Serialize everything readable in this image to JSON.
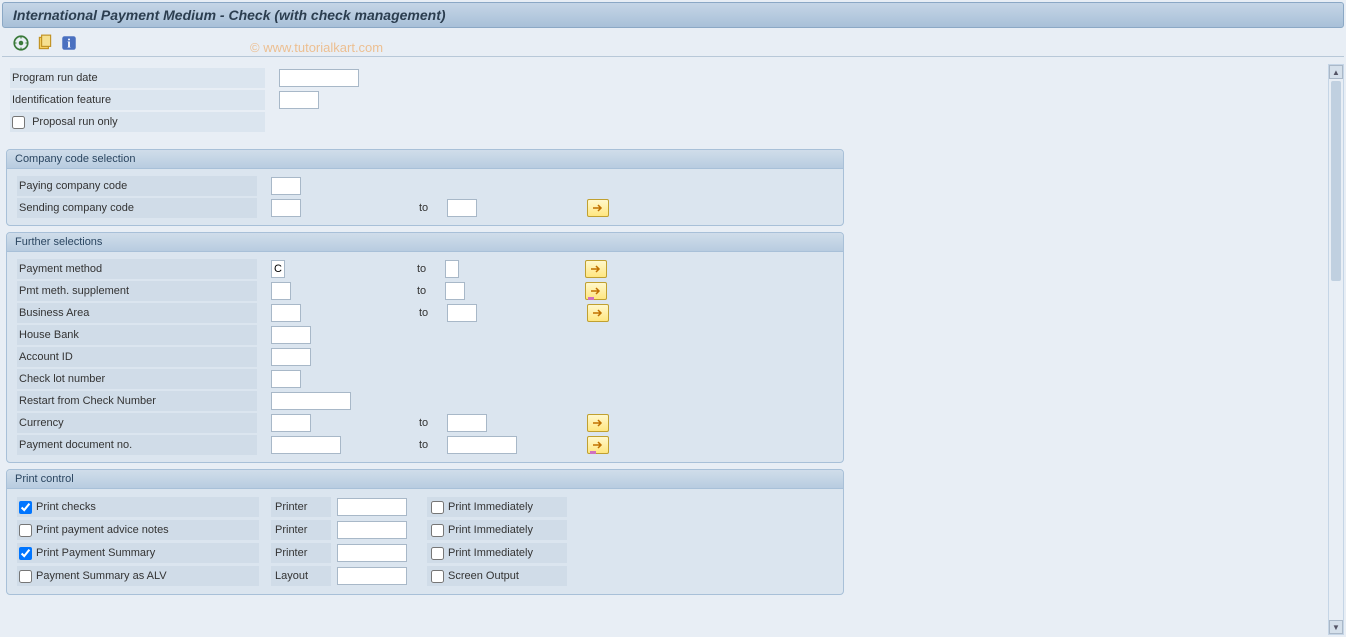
{
  "title": "International Payment Medium - Check (with check management)",
  "watermark": "© www.tutorialkart.com",
  "top": {
    "program_run_date_label": "Program run date",
    "program_run_date_value": "",
    "identification_feature_label": "Identification feature",
    "identification_feature_value": "",
    "proposal_run_only_label": "Proposal run only",
    "proposal_run_only_checked": false
  },
  "group_company": {
    "title": "Company code selection",
    "paying_company_code_label": "Paying company code",
    "paying_company_code_value": "",
    "sending_company_code_label": "Sending company code",
    "sending_company_code_from": "",
    "to_label": "to",
    "sending_company_code_to": ""
  },
  "group_further": {
    "title": "Further selections",
    "payment_method_label": "Payment method",
    "payment_method_from": "C",
    "payment_method_to": "",
    "pmt_meth_supplement_label": "Pmt meth. supplement",
    "pmt_meth_supplement_from": "",
    "pmt_meth_supplement_to": "",
    "business_area_label": "Business Area",
    "business_area_from": "",
    "business_area_to": "",
    "house_bank_label": "House Bank",
    "house_bank_value": "",
    "account_id_label": "Account ID",
    "account_id_value": "",
    "check_lot_number_label": "Check lot number",
    "check_lot_number_value": "",
    "restart_from_check_number_label": "Restart from Check Number",
    "restart_from_check_number_value": "",
    "currency_label": "Currency",
    "currency_from": "",
    "currency_to": "",
    "payment_document_no_label": "Payment document no.",
    "payment_document_no_from": "",
    "payment_document_no_to": "",
    "to_label": "to"
  },
  "group_print": {
    "title": "Print control",
    "printer_label": "Printer",
    "layout_label": "Layout",
    "print_immediately_label": "Print Immediately",
    "screen_output_label": "Screen Output",
    "rows": [
      {
        "label": "Print checks",
        "checked": true,
        "sub_label": "Printer",
        "printer_value": "",
        "right_label": "Print Immediately",
        "right_checked": false
      },
      {
        "label": "Print payment advice notes",
        "checked": false,
        "sub_label": "Printer",
        "printer_value": "",
        "right_label": "Print Immediately",
        "right_checked": false
      },
      {
        "label": "Print Payment Summary",
        "checked": true,
        "sub_label": "Printer",
        "printer_value": "",
        "right_label": "Print Immediately",
        "right_checked": false
      },
      {
        "label": "Payment Summary as ALV",
        "checked": false,
        "sub_label": "Layout",
        "printer_value": "",
        "right_label": "Screen Output",
        "right_checked": false
      }
    ]
  }
}
